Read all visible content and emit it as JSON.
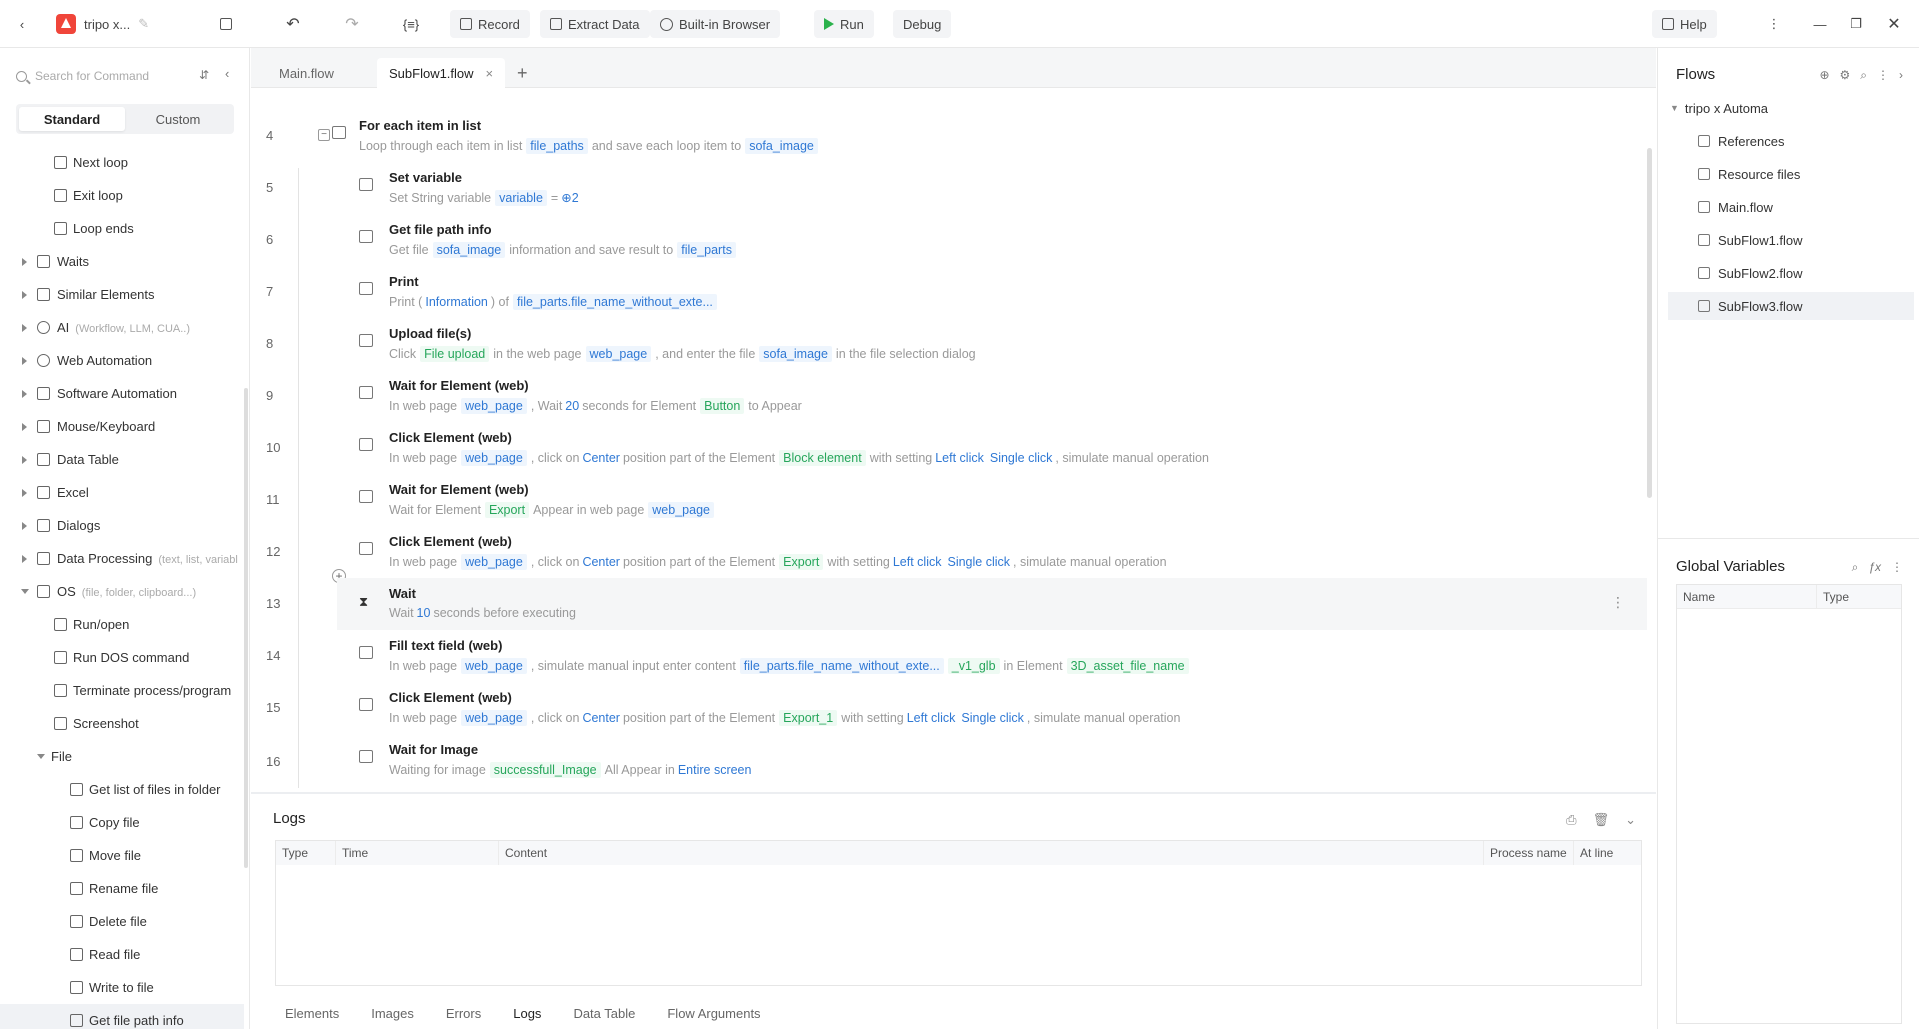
{
  "toolbar": {
    "project_name": "tripo x...",
    "record": "Record",
    "extract": "Extract Data",
    "browser": "Built-in Browser",
    "run": "Run",
    "debug": "Debug",
    "help": "Help"
  },
  "left": {
    "search_placeholder": "Search for Command",
    "tab_standard": "Standard",
    "tab_custom": "Custom",
    "items": [
      {
        "label": "Next loop",
        "hint": ""
      },
      {
        "label": "Exit loop",
        "hint": ""
      },
      {
        "label": "Loop ends",
        "hint": ""
      },
      {
        "label": "Waits",
        "hint": ""
      },
      {
        "label": "Similar Elements",
        "hint": ""
      },
      {
        "label": "AI",
        "hint": "(Workflow, LLM, CUA..)"
      },
      {
        "label": "Web Automation",
        "hint": ""
      },
      {
        "label": "Software Automation",
        "hint": ""
      },
      {
        "label": "Mouse/Keyboard",
        "hint": ""
      },
      {
        "label": "Data Table",
        "hint": ""
      },
      {
        "label": "Excel",
        "hint": ""
      },
      {
        "label": "Dialogs",
        "hint": ""
      },
      {
        "label": "Data Processing",
        "hint": "(text, list, variabl"
      },
      {
        "label": "OS",
        "hint": "(file, folder, clipboard...)"
      },
      {
        "label": "Run/open",
        "hint": ""
      },
      {
        "label": "Run DOS command",
        "hint": ""
      },
      {
        "label": "Terminate process/program",
        "hint": ""
      },
      {
        "label": "Screenshot",
        "hint": ""
      },
      {
        "label": "File",
        "hint": ""
      },
      {
        "label": "Get list of files in folder",
        "hint": ""
      },
      {
        "label": "Copy file",
        "hint": ""
      },
      {
        "label": "Move file",
        "hint": ""
      },
      {
        "label": "Rename file",
        "hint": ""
      },
      {
        "label": "Delete file",
        "hint": ""
      },
      {
        "label": "Read file",
        "hint": ""
      },
      {
        "label": "Write to file",
        "hint": ""
      },
      {
        "label": "Get file path info",
        "hint": ""
      }
    ]
  },
  "tabs": {
    "main": "Main.flow",
    "sub": "SubFlow1.flow",
    "close": "×",
    "add": "+"
  },
  "editor": {
    "lines": [
      "4",
      "5",
      "6",
      "7",
      "8",
      "9",
      "10",
      "11",
      "12",
      "13",
      "14",
      "15",
      "16"
    ],
    "c4": {
      "title": "For each item in list",
      "d1": "Loop through each item in list",
      "t1": "file_paths",
      "d2": "and save each loop item to",
      "t2": "sofa_image"
    },
    "c5": {
      "title": "Set variable",
      "d1": "Set String variable",
      "t1": "variable",
      "d2": "=",
      "t2": "⊕2"
    },
    "c6": {
      "title": "Get file path info",
      "d1": "Get file",
      "t1": "sofa_image",
      "d2": "information and save result to",
      "t2": "file_parts"
    },
    "c7": {
      "title": "Print",
      "d1": "Print (",
      "t1": "Information",
      "d2": ") of",
      "t2": "file_parts.file_name_without_exte..."
    },
    "c8": {
      "title": "Upload file(s)",
      "d1": "Click",
      "t1": "File upload",
      "d2": "in the web page",
      "t2": "web_page",
      "d3": ", and enter the file",
      "t3": "sofa_image",
      "d4": "in the file selection dialog"
    },
    "c9": {
      "title": "Wait for Element (web)",
      "d1": "In web page",
      "t1": "web_page",
      "d2": ", Wait",
      "t2": "20",
      "d3": "seconds for Element",
      "t3": "Button",
      "d4": "to Appear"
    },
    "c10": {
      "title": "Click Element (web)",
      "d1": "In web page",
      "t1": "web_page",
      "d2": ", click on",
      "t2": "Center",
      "d3": "position  part of the Element",
      "t3": "Block element",
      "d4": "with setting",
      "t4": "Left click",
      "t5": "Single click",
      "d5": ", simulate manual operation"
    },
    "c11": {
      "title": "Wait for Element (web)",
      "d1": "Wait for Element",
      "t1": "Export",
      "d2": "Appear in web page",
      "t2": "web_page"
    },
    "c12": {
      "title": "Click Element (web)",
      "d1": "In web page",
      "t1": "web_page",
      "d2": ", click on",
      "t2": "Center",
      "d3": "position  part of the Element",
      "t3": "Export",
      "d4": "with setting",
      "t4": "Left click",
      "t5": "Single click",
      "d5": ", simulate manual operation"
    },
    "c13": {
      "title": "Wait",
      "d1": "Wait",
      "t1": "10",
      "d2": "seconds before executing"
    },
    "c14": {
      "title": "Fill text field (web)",
      "d1": "In web page",
      "t1": "web_page",
      "d2": ", simulate manual input enter content",
      "t2": "file_parts.file_name_without_exte...",
      "t3": "_v1_glb",
      "d3": "in Element",
      "t4": "3D_asset_file_name"
    },
    "c15": {
      "title": "Click Element (web)",
      "d1": "In web page",
      "t1": "web_page",
      "d2": ", click on",
      "t2": "Center",
      "d3": "position  part of the Element",
      "t3": "Export_1",
      "d4": "with setting",
      "t4": "Left click",
      "t5": "Single click",
      "d5": ", simulate manual operation"
    },
    "c16": {
      "title": "Wait for Image",
      "d1": "Waiting for image",
      "t1": "successfull_Image",
      "d2": "All Appear in",
      "t2": "Entire screen"
    }
  },
  "logs": {
    "title": "Logs",
    "cols": [
      "Type",
      "Time",
      "Content",
      "Process name",
      "At line"
    ],
    "tabs": [
      "Elements",
      "Images",
      "Errors",
      "Logs",
      "Data Table",
      "Flow Arguments"
    ]
  },
  "right": {
    "flows_title": "Flows",
    "root": "tripo x Automa",
    "items": [
      "References",
      "Resource files",
      "Main.flow",
      "SubFlow1.flow",
      "SubFlow2.flow",
      "SubFlow3.flow"
    ],
    "gv_title": "Global Variables",
    "gv_cols": [
      "Name",
      "Type"
    ]
  }
}
